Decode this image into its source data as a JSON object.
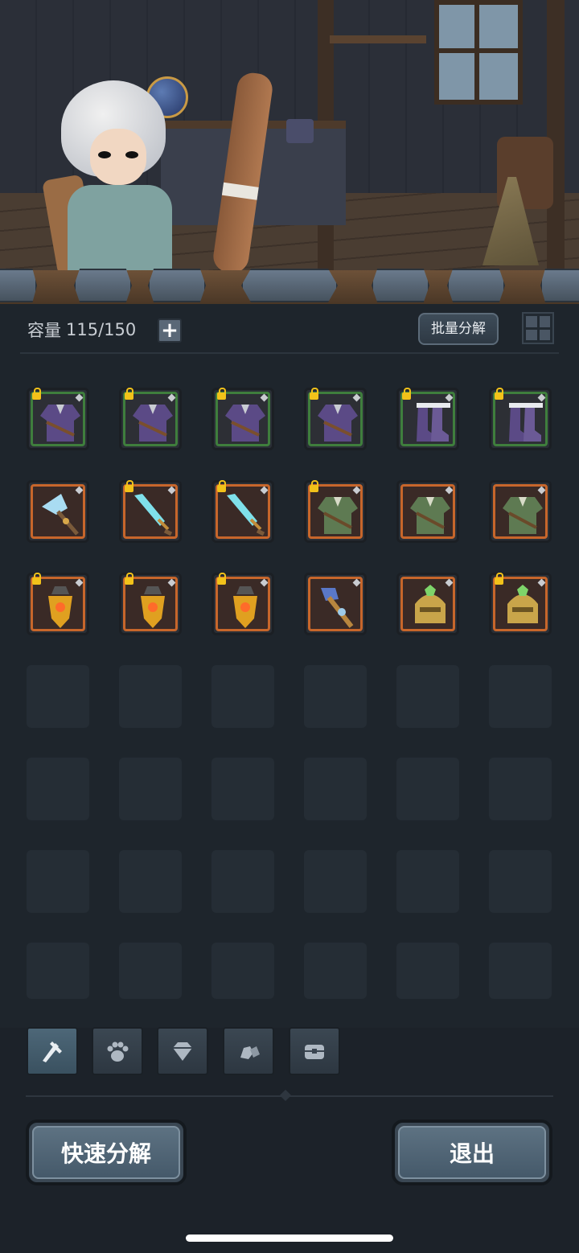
{
  "scene": {
    "icon": "hero-character-scene"
  },
  "capacity": {
    "label": "容量",
    "value": "115/150",
    "add_icon": "plus-icon"
  },
  "toolbar": {
    "batch_label": "批量分解",
    "view_icon": "grid-view-icon"
  },
  "inventory": {
    "items": [
      {
        "name": "armor",
        "icon": "purple-armor-icon",
        "rarity": "green",
        "locked": true
      },
      {
        "name": "armor",
        "icon": "purple-armor-icon",
        "rarity": "green",
        "locked": true
      },
      {
        "name": "armor",
        "icon": "purple-armor-icon",
        "rarity": "green",
        "locked": true
      },
      {
        "name": "armor",
        "icon": "purple-armor-icon",
        "rarity": "green",
        "locked": true
      },
      {
        "name": "boots",
        "icon": "purple-boots-icon",
        "rarity": "green",
        "locked": true
      },
      {
        "name": "boots",
        "icon": "purple-boots-icon",
        "rarity": "green",
        "locked": true
      },
      {
        "name": "axe",
        "icon": "ice-axe-icon",
        "rarity": "orange",
        "locked": false
      },
      {
        "name": "sword",
        "icon": "ice-sword-icon",
        "rarity": "orange",
        "locked": true
      },
      {
        "name": "sword",
        "icon": "ice-sword-icon",
        "rarity": "orange",
        "locked": true
      },
      {
        "name": "armor",
        "icon": "green-tunic-icon",
        "rarity": "orange",
        "locked": true
      },
      {
        "name": "armor",
        "icon": "green-tunic-icon",
        "rarity": "orange",
        "locked": false
      },
      {
        "name": "armor",
        "icon": "green-tunic-icon",
        "rarity": "orange",
        "locked": false
      },
      {
        "name": "amulet",
        "icon": "amber-amulet-icon",
        "rarity": "orange",
        "locked": true
      },
      {
        "name": "amulet",
        "icon": "amber-amulet-icon",
        "rarity": "orange",
        "locked": true
      },
      {
        "name": "amulet",
        "icon": "amber-amulet-icon",
        "rarity": "orange",
        "locked": true
      },
      {
        "name": "staff",
        "icon": "crystal-staff-icon",
        "rarity": "orange",
        "locked": false
      },
      {
        "name": "helmet",
        "icon": "golden-helmet-icon",
        "rarity": "orange",
        "locked": false
      },
      {
        "name": "helmet",
        "icon": "golden-helmet-icon",
        "rarity": "orange",
        "locked": true
      }
    ],
    "empty_slot_count": 24
  },
  "tabs": [
    {
      "icon": "weapons-tab-icon",
      "active": true
    },
    {
      "icon": "paw-tab-icon",
      "active": false
    },
    {
      "icon": "gem-tab-icon",
      "active": false
    },
    {
      "icon": "stones-tab-icon",
      "active": false
    },
    {
      "icon": "chest-tab-icon",
      "active": false
    }
  ],
  "actions": {
    "quick_label": "快速分解",
    "exit_label": "退出"
  },
  "colors": {
    "green_rarity": "#3f7e3d",
    "orange_rarity": "#c7662b",
    "lock": "#f2c21a"
  }
}
